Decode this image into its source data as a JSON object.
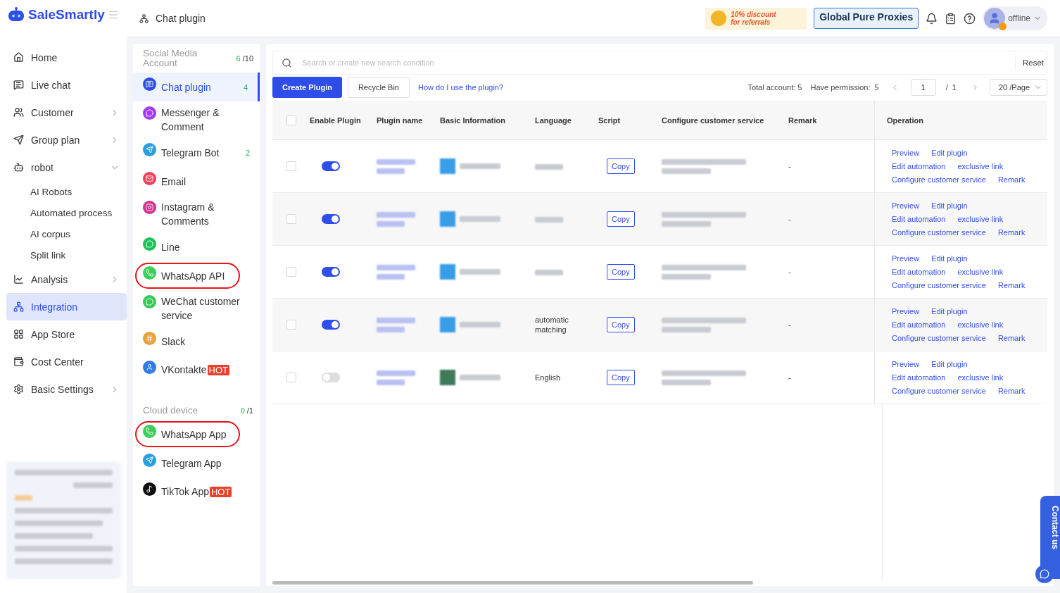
{
  "brand": "SaleSmartly",
  "nav": [
    {
      "label": "Home",
      "selected": false
    },
    {
      "label": "Live chat",
      "selected": false
    },
    {
      "label": "Customer",
      "selected": false,
      "expanded": false
    },
    {
      "label": "Group plan",
      "selected": false,
      "expanded": false
    },
    {
      "label": "robot",
      "selected": false,
      "expanded": true,
      "children": [
        {
          "label": "AI Robots"
        },
        {
          "label": "Automated process"
        },
        {
          "label": "AI corpus"
        },
        {
          "label": "Split link"
        }
      ]
    },
    {
      "label": "Analysis",
      "selected": false,
      "expanded": false
    },
    {
      "label": "Integration",
      "selected": true
    },
    {
      "label": "App Store",
      "selected": false
    },
    {
      "label": "Cost Center",
      "selected": false
    },
    {
      "label": "Basic Settings",
      "selected": false,
      "expanded": false
    }
  ],
  "breadcrumb": "Chat plugin",
  "header": {
    "promo_line1": "10% discount",
    "promo_line2": "for referrals",
    "proxy_banner": "Global Pure Proxies",
    "status": "offline"
  },
  "channel_groups": [
    {
      "title": "Social Media Account",
      "used": "6",
      "total": "/10",
      "items": [
        {
          "label": "Chat plugin",
          "color": "#2f4de8",
          "count": "4",
          "selected": true,
          "circled": false
        },
        {
          "label": "Messenger & Comment",
          "color": "#a33bf0",
          "selected": false,
          "circled": false
        },
        {
          "label": "Telegram Bot",
          "color": "#2a9fe0",
          "count": "2",
          "selected": false,
          "circled": false
        },
        {
          "label": "Email",
          "color": "#f0435a",
          "selected": false,
          "circled": false
        },
        {
          "label": "Instagram & Comments",
          "color": "#d62f8c",
          "selected": false,
          "circled": false
        },
        {
          "label": "Line",
          "color": "#1fc15a",
          "selected": false,
          "circled": false
        },
        {
          "label": "WhatsApp API",
          "color": "#3ccf5a",
          "selected": false,
          "circled": true
        },
        {
          "label": "WeChat customer service",
          "color": "#3cc85a",
          "selected": false,
          "circled": false
        },
        {
          "label": "Slack",
          "color": "#e8a33b",
          "selected": false,
          "circled": false
        },
        {
          "label": "VKontakte",
          "color": "#2f7be8",
          "badge": "HOT",
          "selected": false,
          "circled": false
        }
      ]
    },
    {
      "title": "Cloud device",
      "used": "0",
      "total": "/1",
      "items": [
        {
          "label": "WhatsApp App",
          "color": "#3ccf5a",
          "selected": false,
          "circled": true
        },
        {
          "label": "Telegram App",
          "color": "#2a9fe0",
          "selected": false,
          "circled": false
        },
        {
          "label": "TikTok App",
          "color": "#111111",
          "badge": "HOT",
          "selected": false,
          "circled": false
        }
      ]
    }
  ],
  "search": {
    "placeholder": "Search or create new search condition",
    "reset": "Reset"
  },
  "toolbar": {
    "create": "Create Plugin",
    "recycle": "Recycle Bin",
    "help_link": "How do I use the plugin?",
    "total": "Total account: 5",
    "permission": "Have permission:  5",
    "page": "1",
    "pages": "/  1",
    "page_size": "20 /Page"
  },
  "table": {
    "all_checked": false,
    "columns": [
      "Enable Plugin",
      "Plugin name",
      "Basic Information",
      "Language",
      "Script",
      "Configure customer service",
      "Remark",
      "Operation"
    ],
    "rows": [
      {
        "checked": false,
        "enabled": true,
        "color": "#3a9de8",
        "script": "Copy",
        "remark": "-",
        "operations": [
          "Preview",
          "Edit plugin",
          "Edit automation",
          "exclusive link",
          "Configure customer service",
          "Remark"
        ]
      },
      {
        "checked": false,
        "enabled": true,
        "color": "#3a9de8",
        "script": "Copy",
        "remark": "-",
        "operations": [
          "Preview",
          "Edit plugin",
          "Edit automation",
          "exclusive link",
          "Configure customer service",
          "Remark"
        ]
      },
      {
        "checked": false,
        "enabled": true,
        "color": "#3a9de8",
        "script": "Copy",
        "remark": "-",
        "operations": [
          "Preview",
          "Edit plugin",
          "Edit automation",
          "exclusive link",
          "Configure customer service",
          "Remark"
        ]
      },
      {
        "checked": false,
        "enabled": true,
        "color": "#3a9de8",
        "language": "automatic matching",
        "script": "Copy",
        "remark": "-",
        "operations": [
          "Preview",
          "Edit plugin",
          "Edit automation",
          "exclusive link",
          "Configure customer service",
          "Remark"
        ]
      },
      {
        "checked": false,
        "enabled": false,
        "color": "#3f7a5a",
        "language": "English",
        "script": "Copy",
        "remark": "-",
        "operations": [
          "Preview",
          "Edit plugin",
          "Edit automation",
          "exclusive link",
          "Configure customer service",
          "Remark"
        ]
      }
    ]
  },
  "contact": "Contact us"
}
